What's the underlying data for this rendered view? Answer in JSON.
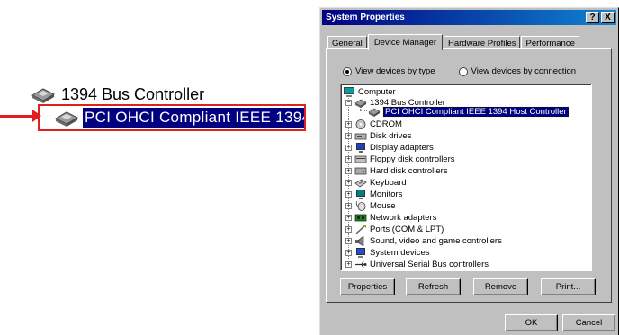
{
  "zoom": {
    "controller_label": "1394 Bus Controller",
    "selected_label": "PCI OHCI Compliant IEEE 1394 H"
  },
  "dialog": {
    "title": "System Properties",
    "title_buttons": [
      "?",
      "X"
    ],
    "tabs": [
      "General",
      "Device Manager",
      "Hardware Profiles",
      "Performance"
    ],
    "active_tab": "Device Manager",
    "view_options": {
      "by_type": "View devices by type",
      "by_connection": "View devices by connection",
      "selected": "by_type"
    },
    "tree": {
      "root": "Computer",
      "expanded": {
        "label": "1394 Bus Controller",
        "child": "PCI OHCI Compliant IEEE 1394 Host Controller"
      },
      "items": [
        {
          "label": "CDROM",
          "icon": "cdrom-icon"
        },
        {
          "label": "Disk drives",
          "icon": "disk-drive-icon"
        },
        {
          "label": "Display adapters",
          "icon": "display-adapter-icon"
        },
        {
          "label": "Floppy disk controllers",
          "icon": "floppy-controller-icon"
        },
        {
          "label": "Hard disk controllers",
          "icon": "hard-disk-controller-icon"
        },
        {
          "label": "Keyboard",
          "icon": "keyboard-icon"
        },
        {
          "label": "Monitors",
          "icon": "monitor-icon"
        },
        {
          "label": "Mouse",
          "icon": "mouse-icon"
        },
        {
          "label": "Network adapters",
          "icon": "network-adapter-icon"
        },
        {
          "label": "Ports (COM & LPT)",
          "icon": "port-icon"
        },
        {
          "label": "Sound, video and game controllers",
          "icon": "sound-icon"
        },
        {
          "label": "System devices",
          "icon": "system-device-icon"
        },
        {
          "label": "Universal Serial Bus controllers",
          "icon": "usb-icon"
        }
      ]
    },
    "buttons": {
      "properties": "Properties",
      "refresh": "Refresh",
      "remove": "Remove",
      "print": "Print...",
      "ok": "OK",
      "cancel": "Cancel"
    },
    "colors": {
      "selection": "#000080",
      "callout": "#e02020",
      "face": "#c0c0c0"
    }
  }
}
